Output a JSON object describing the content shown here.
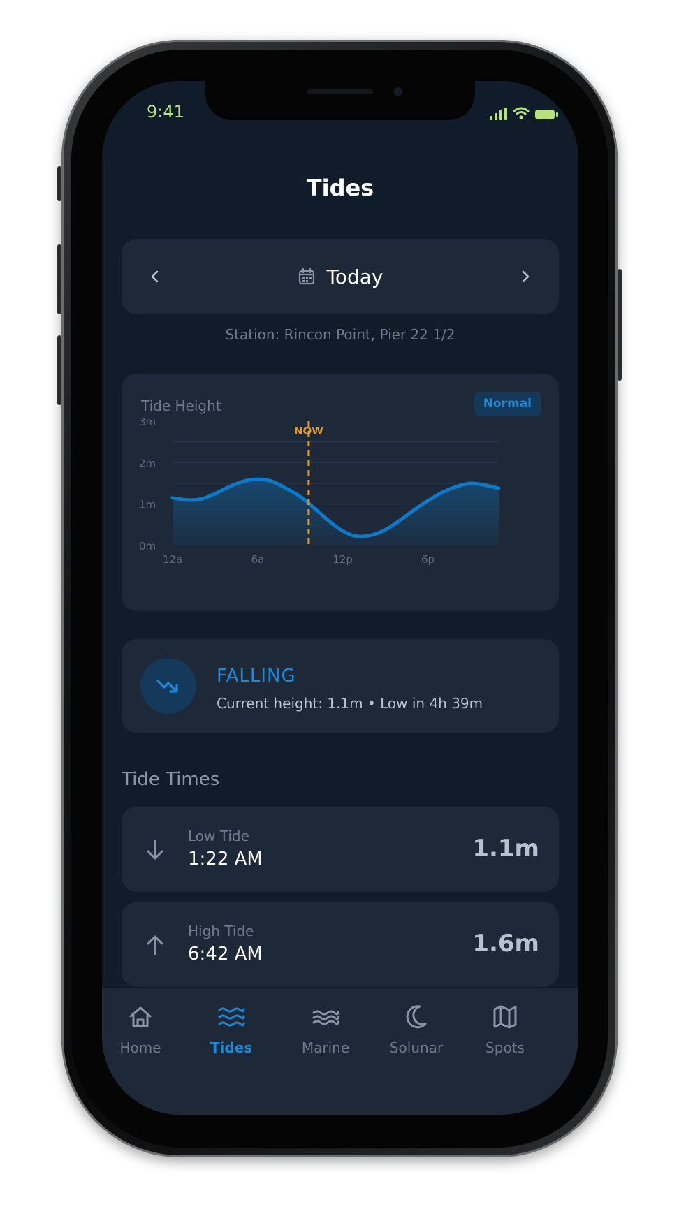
{
  "status_bar": {
    "time": "9:41"
  },
  "header": {
    "title": "Tides"
  },
  "date_nav": {
    "label": "Today"
  },
  "station": "Station: Rincon Point, Pier 22 1/2",
  "chart_card": {
    "title": "Tide Height",
    "badge": "Normal",
    "now_label": "NOW"
  },
  "chart_data": {
    "type": "area",
    "title": "Tide Height",
    "x_tick_labels": [
      "12a",
      "6a",
      "12p",
      "6p"
    ],
    "y_tick_labels": [
      "0m",
      "1m",
      "2m",
      "3m"
    ],
    "ylim": [
      0,
      3
    ],
    "xlim": [
      0,
      23
    ],
    "now_hour": 9.6,
    "x": [
      0,
      1,
      2,
      3,
      4,
      5,
      6,
      7,
      8,
      9,
      10,
      11,
      12,
      13,
      14,
      15,
      16,
      17,
      18,
      19,
      20,
      21,
      22,
      23
    ],
    "y": [
      1.15,
      1.1,
      1.12,
      1.25,
      1.42,
      1.55,
      1.6,
      1.55,
      1.38,
      1.18,
      0.9,
      0.6,
      0.35,
      0.22,
      0.25,
      0.38,
      0.6,
      0.85,
      1.08,
      1.28,
      1.42,
      1.5,
      1.46,
      1.38
    ],
    "line_color": "#0b7acb",
    "now_color": "#e39a2d",
    "grid": true
  },
  "trend": {
    "status": "FALLING",
    "detail": "Current height: 1.1m • Low in 4h 39m"
  },
  "tide_times": {
    "title": "Tide Times",
    "items": [
      {
        "label": "Low Tide",
        "time": "1:22 AM",
        "height": "1.1m",
        "direction": "down"
      },
      {
        "label": "High Tide",
        "time": "6:42 AM",
        "height": "1.6m",
        "direction": "up"
      }
    ]
  },
  "tab_bar": {
    "items": [
      {
        "label": "Home",
        "icon": "home-icon",
        "active": false
      },
      {
        "label": "Tides",
        "icon": "waves-icon",
        "active": true
      },
      {
        "label": "Marine",
        "icon": "marine-waves-icon",
        "active": false
      },
      {
        "label": "Solunar",
        "icon": "moon-icon",
        "active": false
      },
      {
        "label": "Spots",
        "icon": "map-icon",
        "active": false
      }
    ]
  },
  "colors": {
    "accent": "#1c88d6",
    "status_bar": "#b7e37a",
    "background": "#111c2a",
    "card": "#1d2939"
  }
}
